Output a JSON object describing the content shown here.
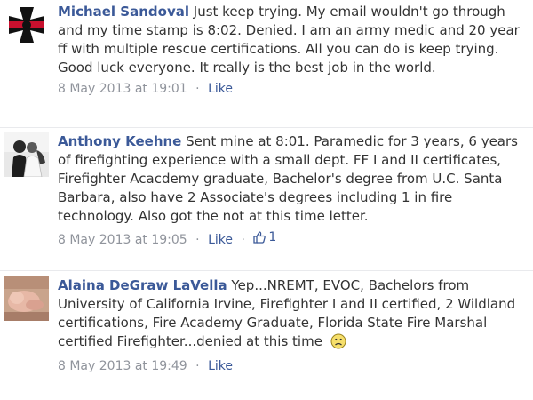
{
  "comments": [
    {
      "author": "Michael Sandoval",
      "text": "Just keep trying. My email wouldn't go through and my time stamp is 8:02. Denied. I am an army medic and 20 year ff with multiple rescue certifications. All you can do is keep trying. Good luck everyone. It really is the best job in the world.",
      "timestamp": "8 May 2013 at 19:01",
      "like_label": "Like",
      "avatar_icon": "maltese-cross-icon"
    },
    {
      "author": "Anthony Keehne",
      "text": "Sent mine at 8:01. Paramedic for 3 years, 6 years of firefighting experience with a small dept. FF I and II certificates, Firefighter Acacdemy graduate, Bachelor's degree from U.C. Santa Barbara, also have 2 Associate's degrees including 1 in fire technology. Also got the not at this time letter.",
      "timestamp": "8 May 2013 at 19:05",
      "like_label": "Like",
      "like_count": "1",
      "avatar_icon": "couple-photo-avatar"
    },
    {
      "author": "Alaina DeGraw LaVella",
      "text": "Yep...NREMT, EVOC, Bachelors from University of California Irvine, Firefighter I and II certified, 2 Wildland certifications, Fire Academy Graduate, Florida State Fire Marshal certified Firefighter...denied at this time",
      "timestamp": "8 May 2013 at 19:49",
      "like_label": "Like",
      "avatar_icon": "baby-photo-avatar",
      "emoji": "sad-face-icon"
    }
  ],
  "separator": "·",
  "colors": {
    "link": "#3b5998",
    "meta": "#90949c",
    "text": "#333333",
    "divider": "#e9eaed"
  }
}
